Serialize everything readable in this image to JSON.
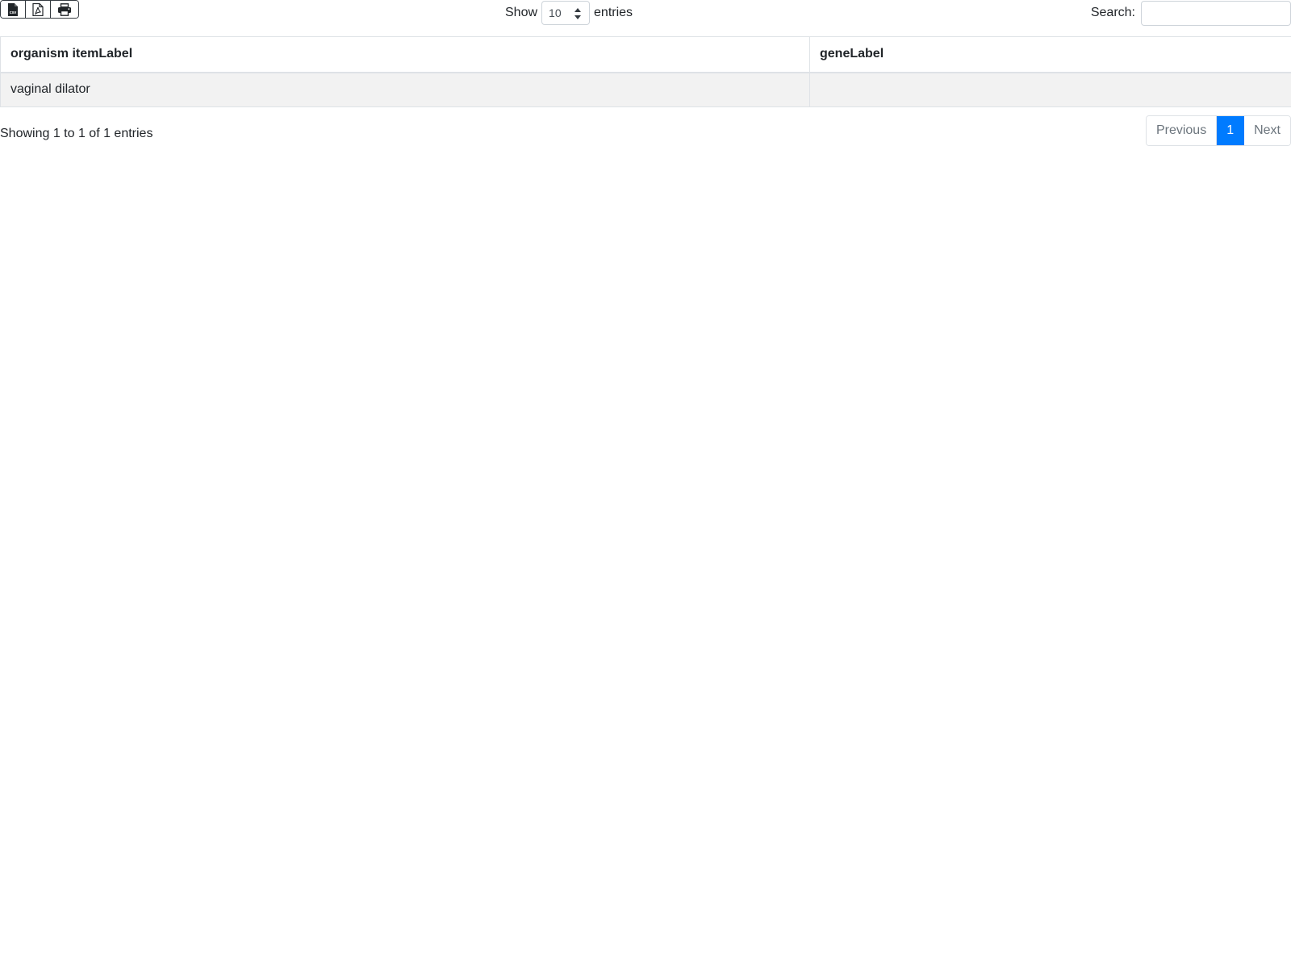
{
  "toolbar": {
    "export_buttons": [
      {
        "icon": "csv-file-icon"
      },
      {
        "icon": "pdf-file-icon"
      },
      {
        "icon": "print-icon"
      }
    ],
    "csv_icon_text": "csv",
    "show_label": "Show",
    "length_value": "10",
    "entries_label": "entries",
    "search_label": "Search:",
    "search_value": "",
    "search_placeholder": ""
  },
  "table": {
    "columns": [
      "organism itemLabel",
      "geneLabel"
    ],
    "rows": [
      [
        "vaginal dilator",
        ""
      ]
    ]
  },
  "footer": {
    "info": "Showing 1 to 1 of 1 entries",
    "pagination": {
      "previous": "Previous",
      "current_page": "1",
      "next": "Next"
    }
  },
  "colors": {
    "accent": "#007bff",
    "row_stripe": "#f2f2f2",
    "border": "#dee2e6"
  }
}
